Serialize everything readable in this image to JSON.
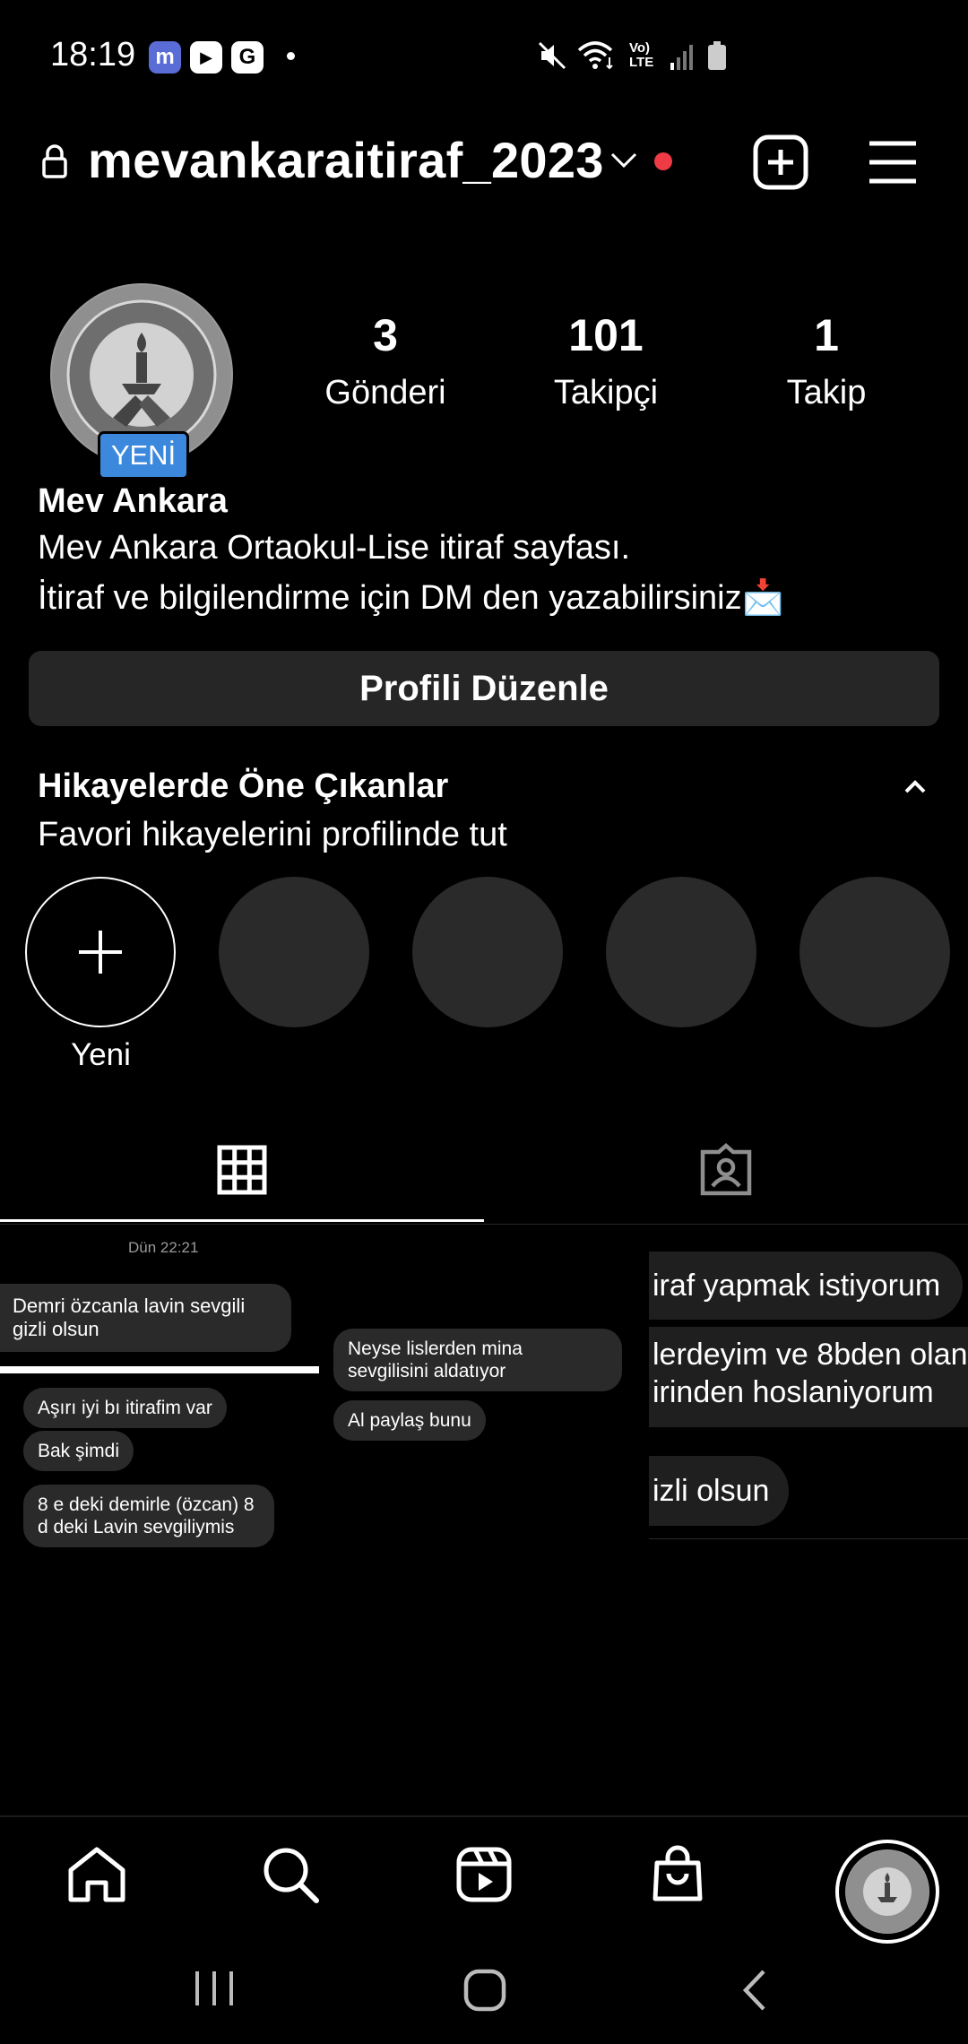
{
  "status_bar": {
    "time": "18:19",
    "apps": [
      "m",
      "▶",
      "G"
    ],
    "icons": [
      "mute-icon",
      "wifi-icon",
      "volte-icon",
      "signal-icon",
      "battery-icon"
    ],
    "volte_top": "Vo)",
    "volte_bottom": "LTE"
  },
  "header": {
    "username": "mevankaraitiraf_2023",
    "icons": [
      "lock-icon",
      "chevron-down-icon",
      "new-post-icon",
      "menu-icon"
    ],
    "notification_color": "#ef3b45"
  },
  "profile": {
    "new_badge": "YENİ",
    "stats": [
      {
        "value": "3",
        "label": "Gönderi"
      },
      {
        "value": "101",
        "label": "Takipçi"
      },
      {
        "value": "1",
        "label": "Takip"
      }
    ],
    "display_name": "Mev Ankara",
    "bio_line_1": "Mev Ankara Ortaokul-Lise itiraf sayfası.",
    "bio_line_2": "İtiraf ve bilgilendirme için DM den yazabilirsiniz📩",
    "edit_button": "Profili Düzenle",
    "badge_color": "#3c88dc"
  },
  "highlights": {
    "title": "Hikayelerde Öne Çıkanlar",
    "subtitle": "Favori hikayelerini profilinde tut",
    "new_label": "Yeni"
  },
  "tabs": [
    "grid-icon",
    "tagged-icon"
  ],
  "posts": [
    {
      "timestamp": "Dün 22:21",
      "messages": [
        "Demri özcanla lavin sevgili gizli olsun",
        "Aşırı iyi bı itirafim var",
        "Bak şimdi",
        "8 e deki demirle (özcan) 8 d deki Lavin sevgiliymis"
      ]
    },
    {
      "messages": [
        "Neyse lislerden mina sevgilisini aldatıyor",
        "Al paylaş bunu"
      ]
    },
    {
      "messages": [
        "iraf yapmak istiyorum",
        "lerdeyim ve 8bden olan",
        "irinden hoslaniyorum",
        "izli olsun"
      ]
    }
  ],
  "bottom_nav": [
    "home-icon",
    "search-icon",
    "reels-icon",
    "shop-icon",
    "profile-avatar"
  ],
  "system_nav": [
    "recents-icon",
    "home-button-icon",
    "back-icon"
  ]
}
